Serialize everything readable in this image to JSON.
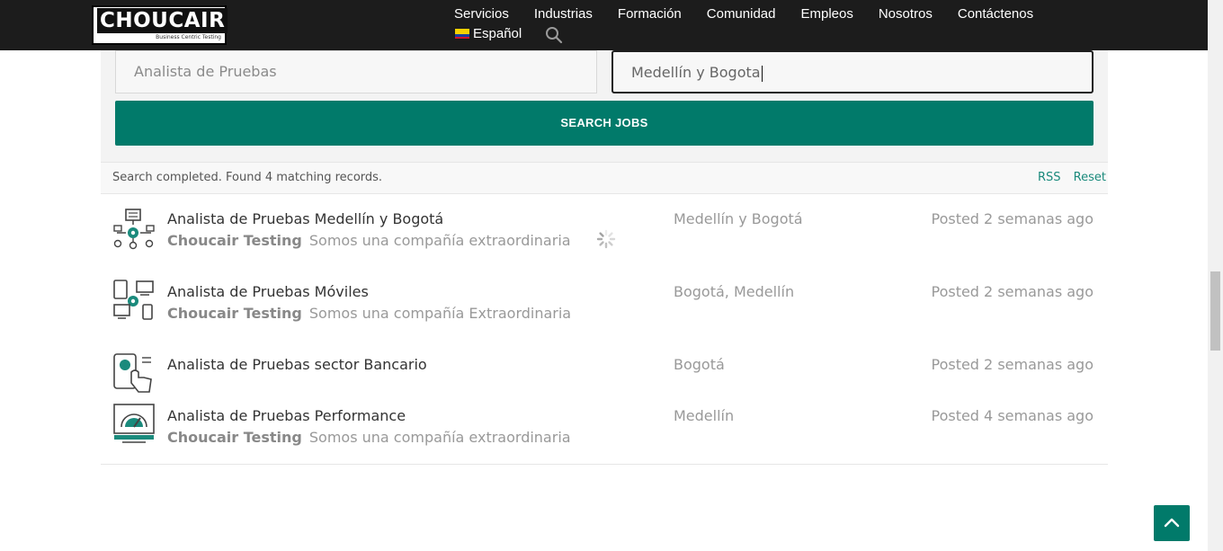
{
  "header": {
    "logo_text": "CHOUCAIR",
    "logo_tagline": "Business Centric Testing",
    "nav": [
      "Servicios",
      "Industrias",
      "Formación",
      "Comunidad",
      "Empleos",
      "Nosotros",
      "Contáctenos"
    ],
    "language": "Español",
    "icons": {
      "search": "search-icon",
      "flag": "colombia-flag-icon"
    }
  },
  "search": {
    "keywords_value": "Analista de Pruebas",
    "location_value": "Medellín y Bogota",
    "button_label": "SEARCH JOBS"
  },
  "status": {
    "message": "Search completed. Found 4 matching records.",
    "rss_label": "RSS",
    "reset_label": "Reset"
  },
  "jobs": [
    {
      "title": "Analista de Pruebas Medellín y Bogotá",
      "company": "Choucair Testing",
      "tagline": "Somos una compañía extraordinaria",
      "location": "Medellín y Bogotá",
      "posted": "Posted 2 semanas ago",
      "icon": "process-gear-icon"
    },
    {
      "title": "Analista de Pruebas Móviles",
      "company": "Choucair Testing",
      "tagline": "Somos una compañía Extraordinaria",
      "location": "Bogotá, Medellín",
      "posted": "Posted 2 semanas ago",
      "icon": "devices-gear-icon"
    },
    {
      "title": "Analista de Pruebas sector Bancario",
      "company": "",
      "tagline": "",
      "location": "Bogotá",
      "posted": "Posted 2 semanas ago",
      "icon": "touch-banking-icon"
    },
    {
      "title": "Analista de Pruebas Performance",
      "company": "Choucair Testing",
      "tagline": "Somos una compañía extraordinaria",
      "location": "Medellín",
      "posted": "Posted 4 semanas ago",
      "icon": "speedometer-icon"
    }
  ],
  "colors": {
    "header_bg": "#1c1c1c",
    "accent": "#017a6a",
    "link": "#1a8a7c"
  },
  "back_to_top_icon": "chevron-up-icon"
}
